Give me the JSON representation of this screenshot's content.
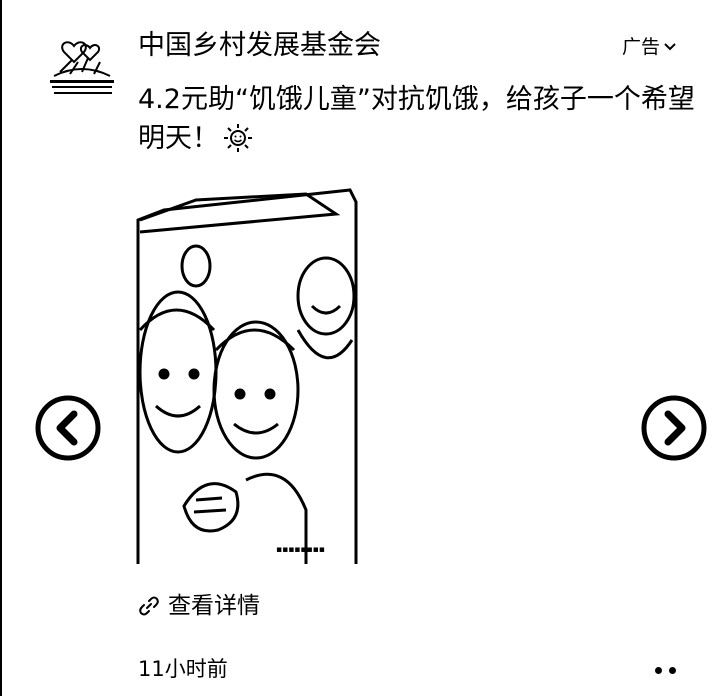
{
  "ad": {
    "advertiser_name": "中国乡村发展基金会",
    "ad_label": "广告",
    "headline": "4.2元助“饥饿儿童”对抗饥饿，给孩子一个希望明天！",
    "detail_link": "查看详情",
    "timestamp": "11小时前",
    "avatar_icon": "foundation-logo-icon",
    "sun_icon": "sun-emoji-icon"
  },
  "colors": {
    "foreground": "#000000",
    "background": "#ffffff"
  }
}
